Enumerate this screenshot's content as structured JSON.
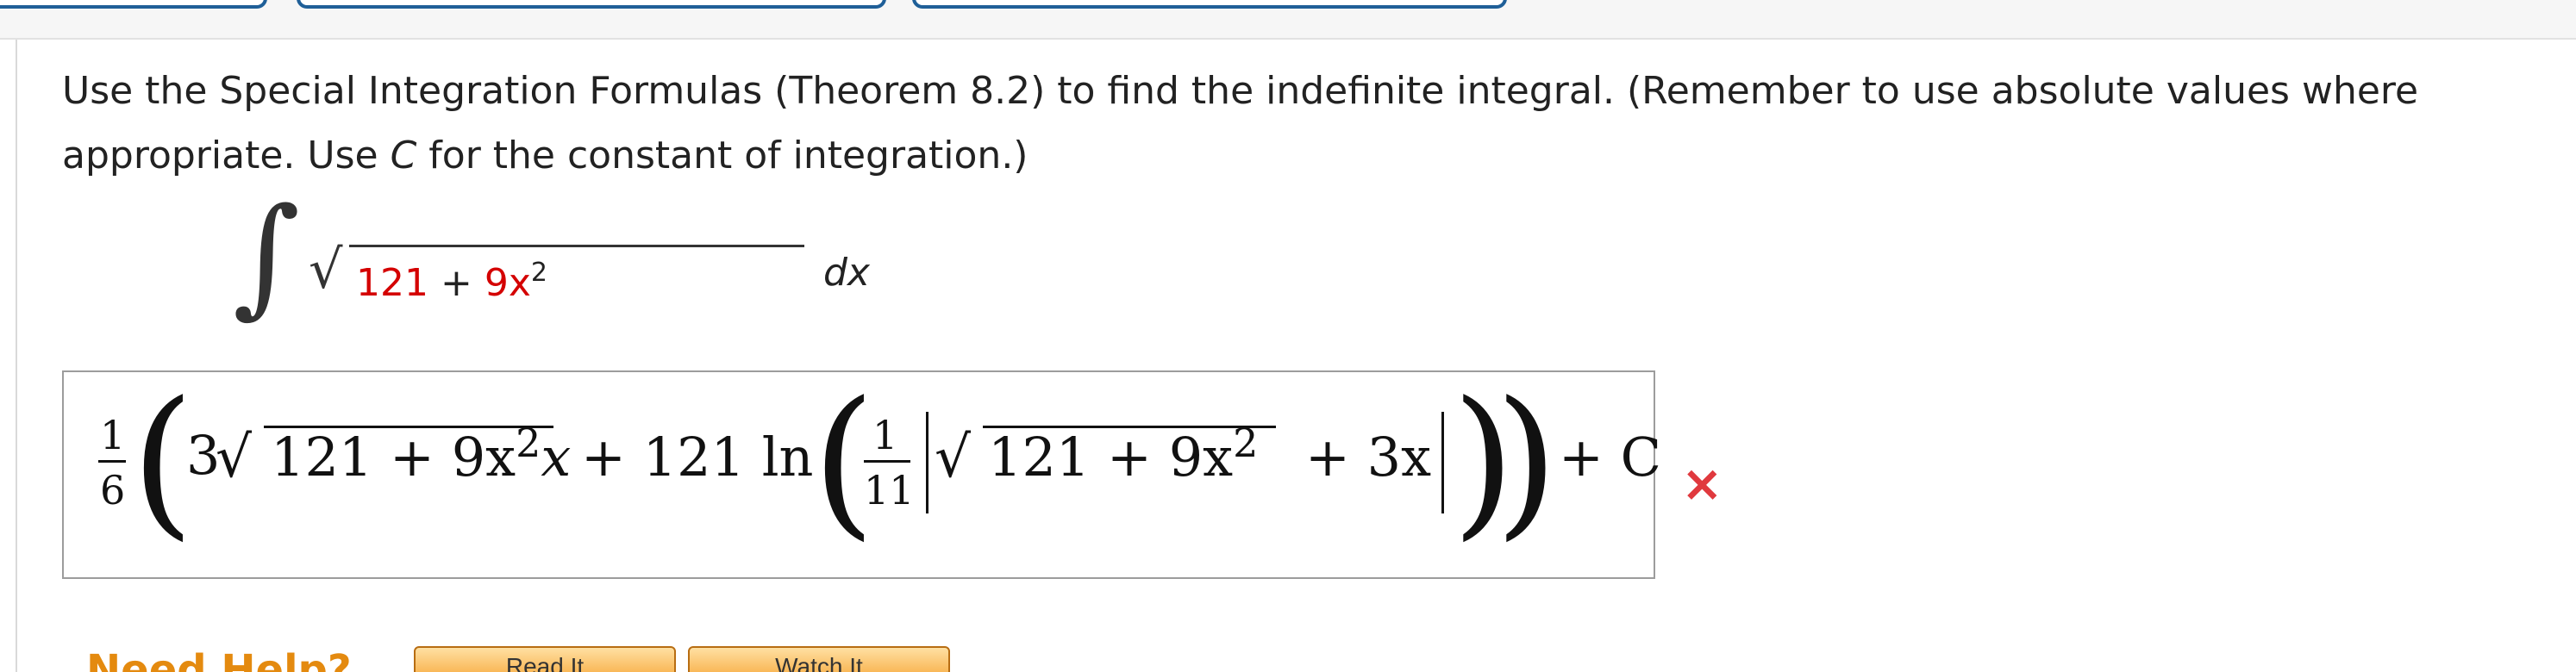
{
  "question": {
    "text_part1": "Use the Special Integration Formulas (Theorem 8.2) to find the indefinite integral. (Remember to use absolute values where appropriate. Use ",
    "text_italic": "C",
    "text_part2": " for the constant of integration.)"
  },
  "integral": {
    "sign": "∫",
    "radical": "√",
    "term1": "121",
    "plus": " + ",
    "term2": "9x",
    "exponent": "2",
    "differential": "dx"
  },
  "answer": {
    "outer_frac_num": "1",
    "outer_frac_den": "6",
    "open_paren": "(",
    "close_paren": ")",
    "coef": "3",
    "radical": "√",
    "radicand1": "121 + 9x",
    "exp1": "2",
    "after_sqrt1": "x",
    "plus_ln": " + 121 ln",
    "inner_frac_num": "1",
    "inner_frac_den": "11",
    "radicand2": "121 + 9x",
    "exp2": "2",
    "plus_3x": "+ 3x",
    "plus_c": "+ C",
    "status": "incorrect"
  },
  "status_icon": "×",
  "help": {
    "label": "Need Help?",
    "read_it": "Read It",
    "watch_it": "Watch It"
  },
  "colors": {
    "highlight": "#d40000",
    "incorrect": "#e0393e",
    "tab_border": "#1f5f98",
    "help_orange": "#e48a0f"
  }
}
